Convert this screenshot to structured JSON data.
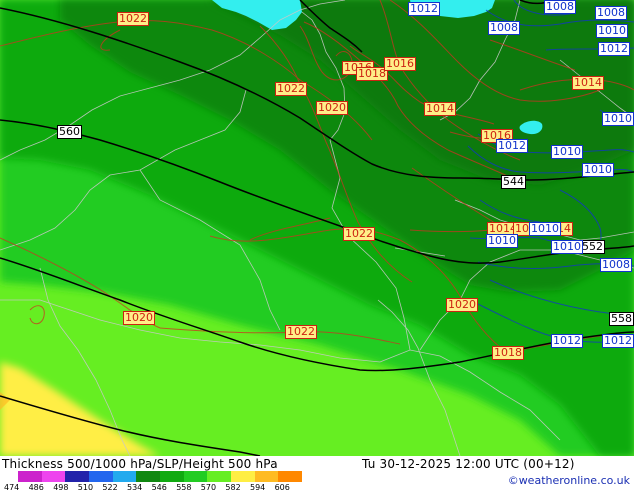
{
  "footer": {
    "title": "Thickness 500/1000 hPa/SLP/Height 500 hPa",
    "datetime": "Tu 30-12-2025 12:00 UTC (00+12)",
    "credit": "©weatheronline.co.uk"
  },
  "legend": {
    "ticks": [
      "474",
      "486",
      "498",
      "510",
      "522",
      "534",
      "546",
      "558",
      "570",
      "582",
      "594",
      "606"
    ],
    "colors": [
      "#cc22cc",
      "#ee44ee",
      "#2222aa",
      "#2266ee",
      "#22aaee",
      "#118811",
      "#11aa11",
      "#22cc22",
      "#66ee22",
      "#ffee44",
      "#ffbb22",
      "#ff8800"
    ]
  },
  "colors": {
    "sea": "#33eeee",
    "thickness_534": "#118811",
    "thickness_546": "#11aa11",
    "thickness_558": "#22cc22",
    "thickness_570": "#66ee22",
    "thickness_582": "#ffee44",
    "slp_high": "#cc3322",
    "slp_low": "#1133cc",
    "height_500": "#000000"
  },
  "labels": {
    "height_500": [
      "560",
      "544",
      "552",
      "558"
    ],
    "slp_high": [
      "1022",
      "1022",
      "1016",
      "1018",
      "1016",
      "1020",
      "1014",
      "1016",
      "1014",
      "1014",
      "1014",
      "1022",
      "1020",
      "1020",
      "1022",
      "1018",
      "1014"
    ],
    "slp_low": [
      "1012",
      "1008",
      "1010",
      "1012",
      "1008",
      "1012",
      "1010",
      "1010",
      "1010",
      "1010",
      "1010",
      "1008",
      "1012",
      "1012",
      "1010",
      "1008"
    ]
  }
}
